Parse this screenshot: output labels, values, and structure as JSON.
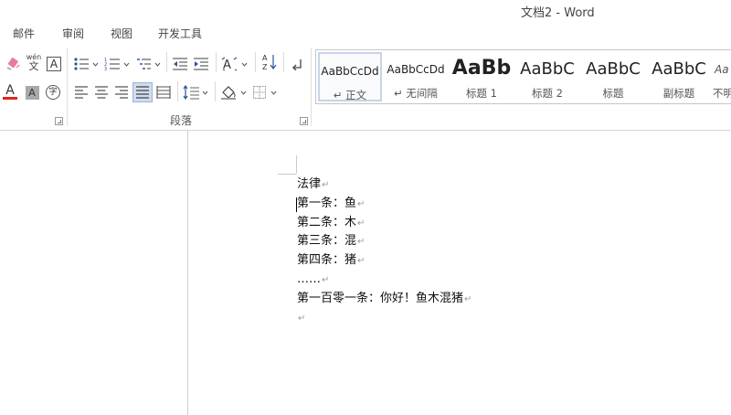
{
  "window": {
    "title": "文档2 - Word"
  },
  "tabs": [
    "邮件",
    "审阅",
    "视图",
    "开发工具"
  ],
  "ribbon": {
    "paragraph_group_label": "段落",
    "styles": [
      {
        "sample": "AaBbCcDd",
        "name": "↵ 正文",
        "selected": true
      },
      {
        "sample": "AaBbCcDd",
        "name": "↵ 无间隔",
        "selected": false
      },
      {
        "sample": "AaBb",
        "name": "标题 1",
        "selected": false
      },
      {
        "sample": "AaBbC",
        "name": "标题 2",
        "selected": false
      },
      {
        "sample": "AaBbC",
        "name": "标题",
        "selected": false
      },
      {
        "sample": "AaBbC",
        "name": "副标题",
        "selected": false
      },
      {
        "sample": "Aa",
        "name": "不明",
        "selected": false
      }
    ],
    "phonetic_top": "wén",
    "phonetic_bottom": "文",
    "border_char_A": "A",
    "shade_char_A": "A",
    "enclose_char": "字",
    "font_color_A": "A",
    "sort_label": "A↓Z"
  },
  "colors": {
    "accent": "#2b579a",
    "font_red": "#e2231a",
    "selected_align_bg": "#cfdcee"
  },
  "document": {
    "pilcrow": "↵",
    "lines": [
      "法律",
      "第一条：鱼",
      "第二条：木",
      "第三条：混",
      "第四条：猪",
      "……",
      "第一百零一条：你好！鱼木混猪",
      ""
    ]
  }
}
